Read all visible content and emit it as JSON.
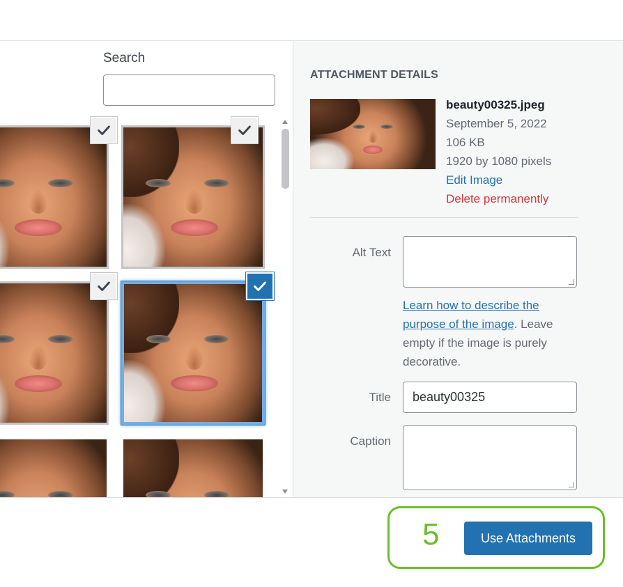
{
  "search": {
    "label": "Search",
    "value": ""
  },
  "attachment_details": {
    "heading": "ATTACHMENT DETAILS",
    "filename": "beauty00325.jpeg",
    "date": "September 5, 2022",
    "filesize": "106 KB",
    "dimensions": "1920 by 1080 pixels",
    "edit_link": "Edit Image",
    "delete_link": "Delete permanently"
  },
  "fields": {
    "alt_text": {
      "label": "Alt Text",
      "value": ""
    },
    "alt_help_link": "Learn how to describe the purpose of the image",
    "alt_help_rest": ". Leave empty if the image is purely decorative.",
    "title": {
      "label": "Title",
      "value": "beauty00325"
    },
    "caption": {
      "label": "Caption",
      "value": ""
    }
  },
  "footer": {
    "selection_count": "5",
    "use_button_label": "Use Attachments"
  },
  "colors": {
    "accent": "#2271b1",
    "delete": "#d63638",
    "highlight": "#6abf2c"
  },
  "grid_items": [
    {
      "icon": "checkmark-icon",
      "checked": true,
      "selected": false
    },
    {
      "icon": "checkmark-icon",
      "checked": true,
      "selected": false
    },
    {
      "icon": "checkmark-icon",
      "checked": true,
      "selected": false
    },
    {
      "icon": "checkmark-icon",
      "checked": true,
      "selected": true
    },
    {
      "icon": "none",
      "checked": false,
      "selected": false
    },
    {
      "icon": "none",
      "checked": false,
      "selected": false
    }
  ]
}
